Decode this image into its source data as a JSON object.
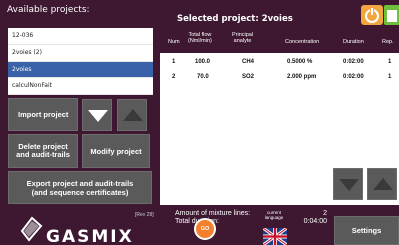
{
  "left_panel": {
    "title": "Available projects:",
    "projects": [
      {
        "name": "12-036",
        "selected": false
      },
      {
        "name": "2voies (2)",
        "selected": false
      },
      {
        "name": "2voies",
        "selected": true
      },
      {
        "name": "calculNonFait",
        "selected": false
      }
    ],
    "import_label": "Import project",
    "delete_label_1": "Delete project",
    "delete_label_2": "and audit-trails",
    "modify_label": "Modify project",
    "export_label_1": "Export project and audit-trails",
    "export_label_2": "(and sequence certificates)"
  },
  "right_panel": {
    "title": "Selected project: 2voies",
    "headers": {
      "num": "Num",
      "flow_1": "Total flow",
      "flow_2": "(Nml/min)",
      "analyte_1": "Principal",
      "analyte_2": "analyte",
      "concentration": "Concentration",
      "duration": "Duration",
      "rep": "Rep."
    },
    "rows": [
      {
        "num": "1",
        "flow": "100.0",
        "analyte": "CH4",
        "concentration": "0.5000 %",
        "duration": "0:02:00",
        "rep": "1"
      },
      {
        "num": "2",
        "flow": "70.0",
        "analyte": "SO2",
        "concentration": "2.000 ppm",
        "duration": "0:02:00",
        "rep": "1"
      }
    ],
    "summary": {
      "lines_label": "Amount of mixture lines:",
      "duration_label": "Total duration:",
      "lines_value": "2",
      "duration_value": "0:04:00"
    }
  },
  "footer": {
    "logo_text": "GASMIX",
    "rev": "[Rev 28]",
    "go_label": "GO",
    "language_label_1": "current",
    "language_label_2": "language",
    "settings_label": "Settings"
  },
  "icons": [
    "power-icon",
    "document-icon",
    "arrow-down-icon",
    "arrow-up-icon",
    "uk-flag-icon"
  ],
  "colors": {
    "background": "#3d1830",
    "selection": "#3a62a8",
    "button": "#5a5a5a",
    "go": "#f47f2d",
    "power": "#f2a640",
    "document": "#6fbf3c"
  }
}
